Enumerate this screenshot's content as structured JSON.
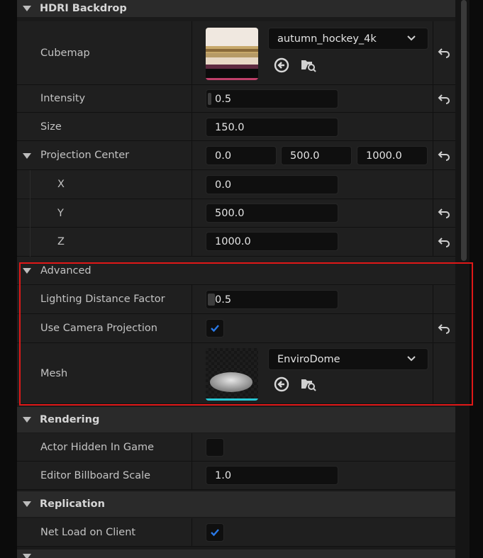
{
  "sections": {
    "hdri": "HDRI Backdrop",
    "advanced": "Advanced",
    "rendering": "Rendering",
    "replication": "Replication"
  },
  "cubemap": {
    "label": "Cubemap",
    "asset": "autumn_hockey_4k",
    "thumb_colors": [
      "#f0e8e0",
      "#8a6a3a",
      "#c7a86a",
      "#5e2a40"
    ]
  },
  "intensity": {
    "label": "Intensity",
    "value": "0.5"
  },
  "size": {
    "label": "Size",
    "value": "150.0"
  },
  "projection_center": {
    "label": "Projection Center",
    "x_value": "0.0",
    "y_value": "500.0",
    "z_value": "1000.0",
    "x_label": "X",
    "y_label": "Y",
    "z_label": "Z"
  },
  "advanced": {
    "lighting_distance_factor": {
      "label": "Lighting Distance Factor",
      "value": "0.5"
    },
    "use_camera_projection": {
      "label": "Use Camera Projection",
      "checked": true
    },
    "mesh": {
      "label": "Mesh",
      "asset": "EnviroDome",
      "accent": "#27c7d4"
    }
  },
  "rendering": {
    "actor_hidden_in_game": {
      "label": "Actor Hidden In Game",
      "checked": false
    },
    "editor_billboard_scale": {
      "label": "Editor Billboard Scale",
      "value": "1.0"
    }
  },
  "replication": {
    "net_load_on_client": {
      "label": "Net Load on Client",
      "checked": true
    }
  },
  "colors": {
    "highlight": "#e01818",
    "check": "#2a7ae8"
  },
  "icons": [
    "reset-arrow-icon",
    "use-selected-arrow-icon",
    "browse-asset-icon",
    "chevron-down-icon",
    "checkmark-icon",
    "collapse-arrow-icon"
  ]
}
